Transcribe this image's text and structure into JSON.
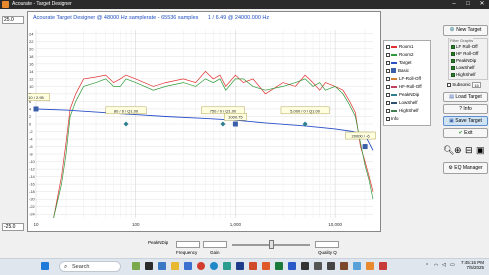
{
  "window": {
    "title": "Acourate - Target Designer"
  },
  "inputs": {
    "top_value": "25.0",
    "bottom_value": "-25.0"
  },
  "chart_title": "Acourate Target Designer @ 48000 Hz samplerate - 65536 samples",
  "chart_subtitle": "1 / 6.49 @ 24000.000 Hz",
  "colors": {
    "room1": "#e03030",
    "room2": "#2f9a3a",
    "target": "#2a50c8",
    "handle": "#2f7e8e",
    "marker": "#3a5fa8",
    "callout_bg": "#ffffe0",
    "callout_border": "#a09030"
  },
  "chart_data": {
    "type": "line",
    "xscale": "log",
    "xlim": [
      10,
      24000
    ],
    "ylim": [
      -25,
      25
    ],
    "y_ticks": [
      "24",
      "22",
      "20",
      "18",
      "16",
      "14",
      "12",
      "10",
      "8",
      "6",
      "4",
      "2",
      "0",
      "-2",
      "-4",
      "-6",
      "-8",
      "-10",
      "-12",
      "-14",
      "-16",
      "-18",
      "-20",
      "-22",
      "-24"
    ],
    "x_ticks": [
      "10",
      "100",
      "1,000",
      "10,000"
    ],
    "series": [
      {
        "name": "Room1",
        "x": [
          15,
          18,
          20,
          22,
          25,
          30,
          40,
          50,
          60,
          70,
          80,
          100,
          150,
          200,
          300,
          400,
          500,
          600,
          700,
          800,
          1000,
          1200,
          1500,
          2000,
          3000,
          4000,
          5000,
          6000,
          7000,
          8000,
          10000,
          12000,
          14000,
          16000,
          18000,
          20000,
          22000,
          24000
        ],
        "y": [
          -25,
          -14,
          -5,
          4,
          8,
          12,
          12.5,
          13,
          11,
          12,
          13,
          12,
          10,
          11,
          12,
          11,
          14,
          12,
          13,
          10,
          13,
          11,
          12,
          8,
          11,
          10,
          13,
          11,
          9,
          11,
          10,
          9,
          6,
          3,
          -6,
          -10,
          -14,
          -18
        ]
      },
      {
        "name": "Room2",
        "x": [
          15,
          18,
          20,
          22,
          25,
          30,
          40,
          50,
          60,
          70,
          80,
          100,
          150,
          200,
          300,
          400,
          500,
          600,
          700,
          800,
          1000,
          1200,
          1500,
          2000,
          3000,
          4000,
          5000,
          6000,
          7000,
          8000,
          10000,
          12000,
          14000,
          16000,
          18000,
          20000,
          22000,
          24000
        ],
        "y": [
          -25,
          -16,
          -8,
          2,
          6,
          10,
          11,
          12,
          10,
          10,
          12,
          11,
          9,
          10,
          11,
          10,
          12,
          11,
          12,
          9,
          12,
          12,
          10,
          9,
          10,
          11,
          12,
          10,
          11,
          9,
          10,
          8,
          5,
          2,
          -5,
          -11,
          -15,
          -20
        ]
      },
      {
        "name": "Target",
        "x": [
          10,
          20,
          50,
          100,
          200,
          500,
          1000,
          2000,
          5000,
          10000,
          15000,
          20000,
          22000,
          24000
        ],
        "y": [
          4,
          3.7,
          3,
          2.5,
          2,
          1.5,
          1,
          0.3,
          -0.5,
          -1.3,
          -2,
          -3,
          -5,
          -7
        ]
      }
    ],
    "controls": [
      {
        "label": "Basic",
        "x": 10,
        "y": 4
      },
      {
        "label": "LF-Roll-Off",
        "x": 80,
        "y": 0
      },
      {
        "label": "HF-Roll-Off",
        "x": 20000,
        "y": -6
      },
      {
        "label": "PeakNDip",
        "x": 750,
        "y": 0
      },
      {
        "label": "LowShelf",
        "x": 1000,
        "y": 0
      },
      {
        "label": "HighShelf",
        "x": 5000,
        "y": 0
      }
    ],
    "annotations": [
      "10 / 2.95",
      "80 / 6 / Q1.00",
      "750 / 0 / Q1.00",
      "5,000 / 0 / Q1.00",
      "1000.75",
      "20000 / -6"
    ]
  },
  "legend": {
    "items": [
      "Room1",
      "Room2",
      "Target",
      "Basic",
      "LF-Roll-Off",
      "HF-Roll-Off",
      "PeakNDip",
      "LowShelf",
      "HighShelf",
      "Info"
    ]
  },
  "right_panel": {
    "new_target": "New Target",
    "graphs_label": "Filter Graphs",
    "graph_items": [
      "LF Roll-Off",
      "HF Roll-Off",
      "PeakNDip",
      "LowShelf",
      "HighShelf"
    ],
    "subsonic_label": "Subsonic",
    "subsonic_value": "15",
    "load_target": "Load Target",
    "info_btn": "? Info",
    "save_target": "Save Target",
    "exit": "Exit",
    "eq_manager": "EQ Manager"
  },
  "bottom": {
    "peak_label": "PeakNDip",
    "frequency_label": "Frequency",
    "gain_label": "Gain",
    "quality_label": "Quality Q"
  },
  "taskbar": {
    "search": "Search",
    "time": "7:45:15 PM",
    "date": "7/5/2025"
  }
}
